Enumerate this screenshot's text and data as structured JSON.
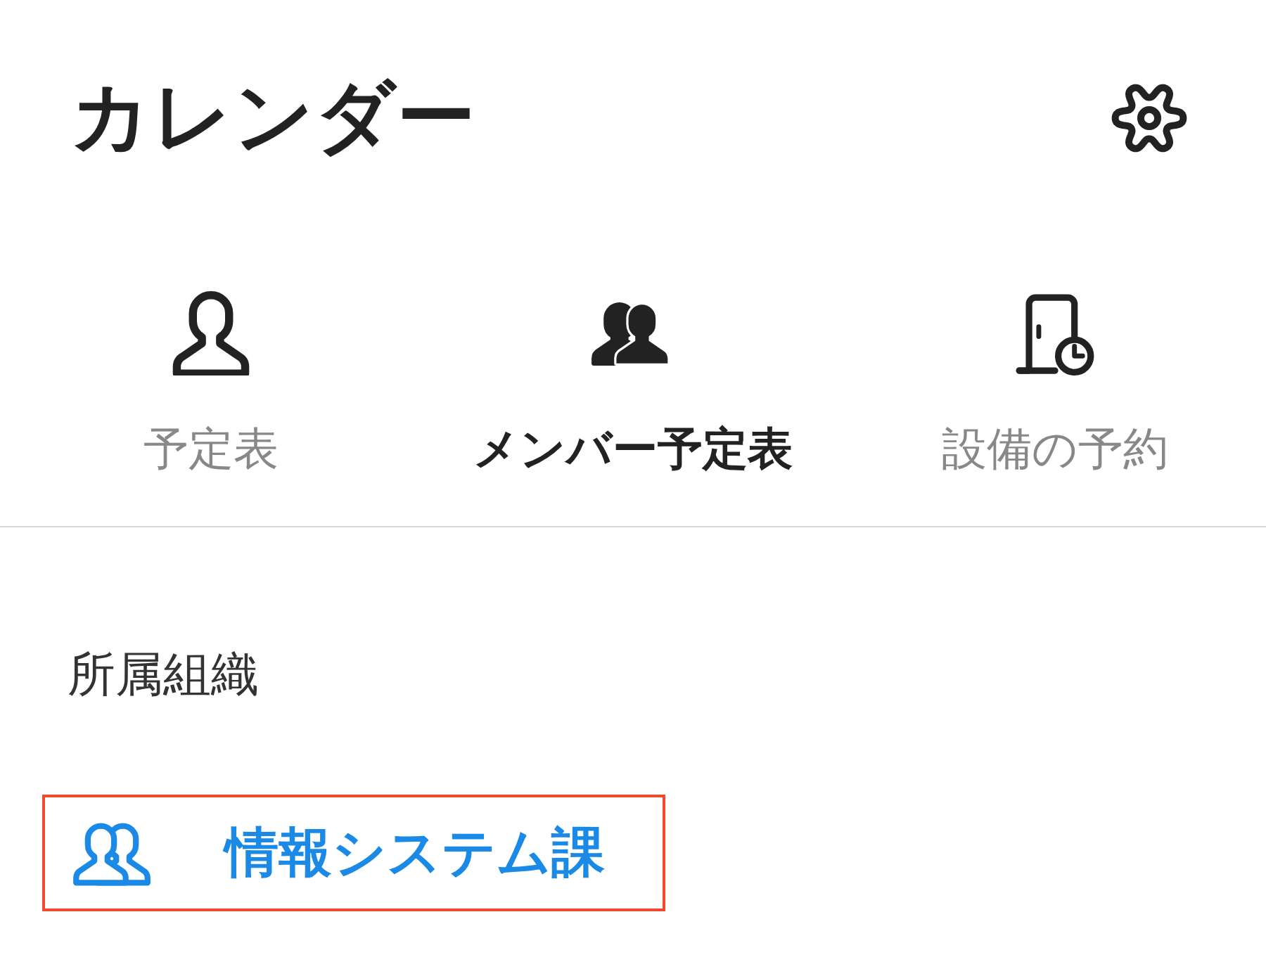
{
  "header": {
    "title": "カレンダー"
  },
  "tabs": [
    {
      "label": "予定表",
      "kind": "single",
      "selected": false
    },
    {
      "label": "メンバー予定表",
      "kind": "group",
      "selected": true
    },
    {
      "label": "設備の予約",
      "kind": "facility",
      "selected": false
    }
  ],
  "section": {
    "heading": "所属組織",
    "items": [
      {
        "label": "情報システム課",
        "highlighted": true
      }
    ]
  }
}
